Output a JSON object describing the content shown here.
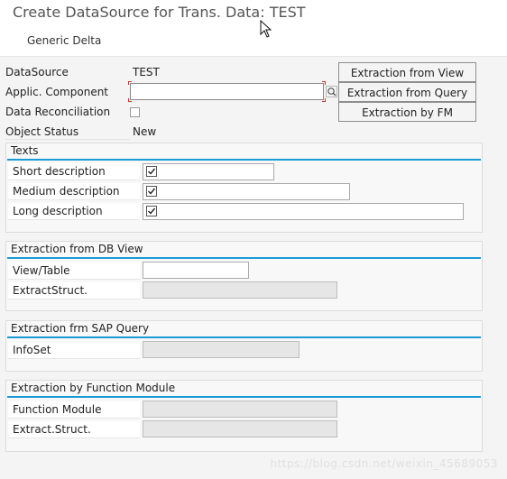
{
  "window": {
    "title": "Create DataSource for Trans. Data: TEST",
    "toolbar_button": "Generic Delta"
  },
  "header_fields": {
    "datasource_label": "DataSource",
    "datasource_value": "TEST",
    "applic_component_label": "Applic. Component",
    "applic_component_value": "",
    "data_reconciliation_label": "Data Reconciliation",
    "object_status_label": "Object Status",
    "object_status_value": "New"
  },
  "extraction_buttons": {
    "from_view": "Extraction from View",
    "from_query": "Extraction from Query",
    "by_fm": "Extraction by FM"
  },
  "texts_group": {
    "title": "Texts",
    "short_label": "Short description",
    "medium_label": "Medium description",
    "long_label": "Long description"
  },
  "db_view_group": {
    "title": "Extraction from DB View",
    "view_table_label": "View/Table",
    "extract_struct_label": "ExtractStruct."
  },
  "sap_query_group": {
    "title": "Extraction frm SAP Query",
    "infoset_label": "InfoSet"
  },
  "fm_group": {
    "title": "Extraction by Function Module",
    "function_module_label": "Function Module",
    "extract_struct_label": "Extract.Struct."
  },
  "watermark": "https://blog.csdn.net/weixin_45689053",
  "icons": {
    "search": "search-icon",
    "cursor": "mouse-cursor-icon",
    "checkmark": "checkmark-icon"
  }
}
